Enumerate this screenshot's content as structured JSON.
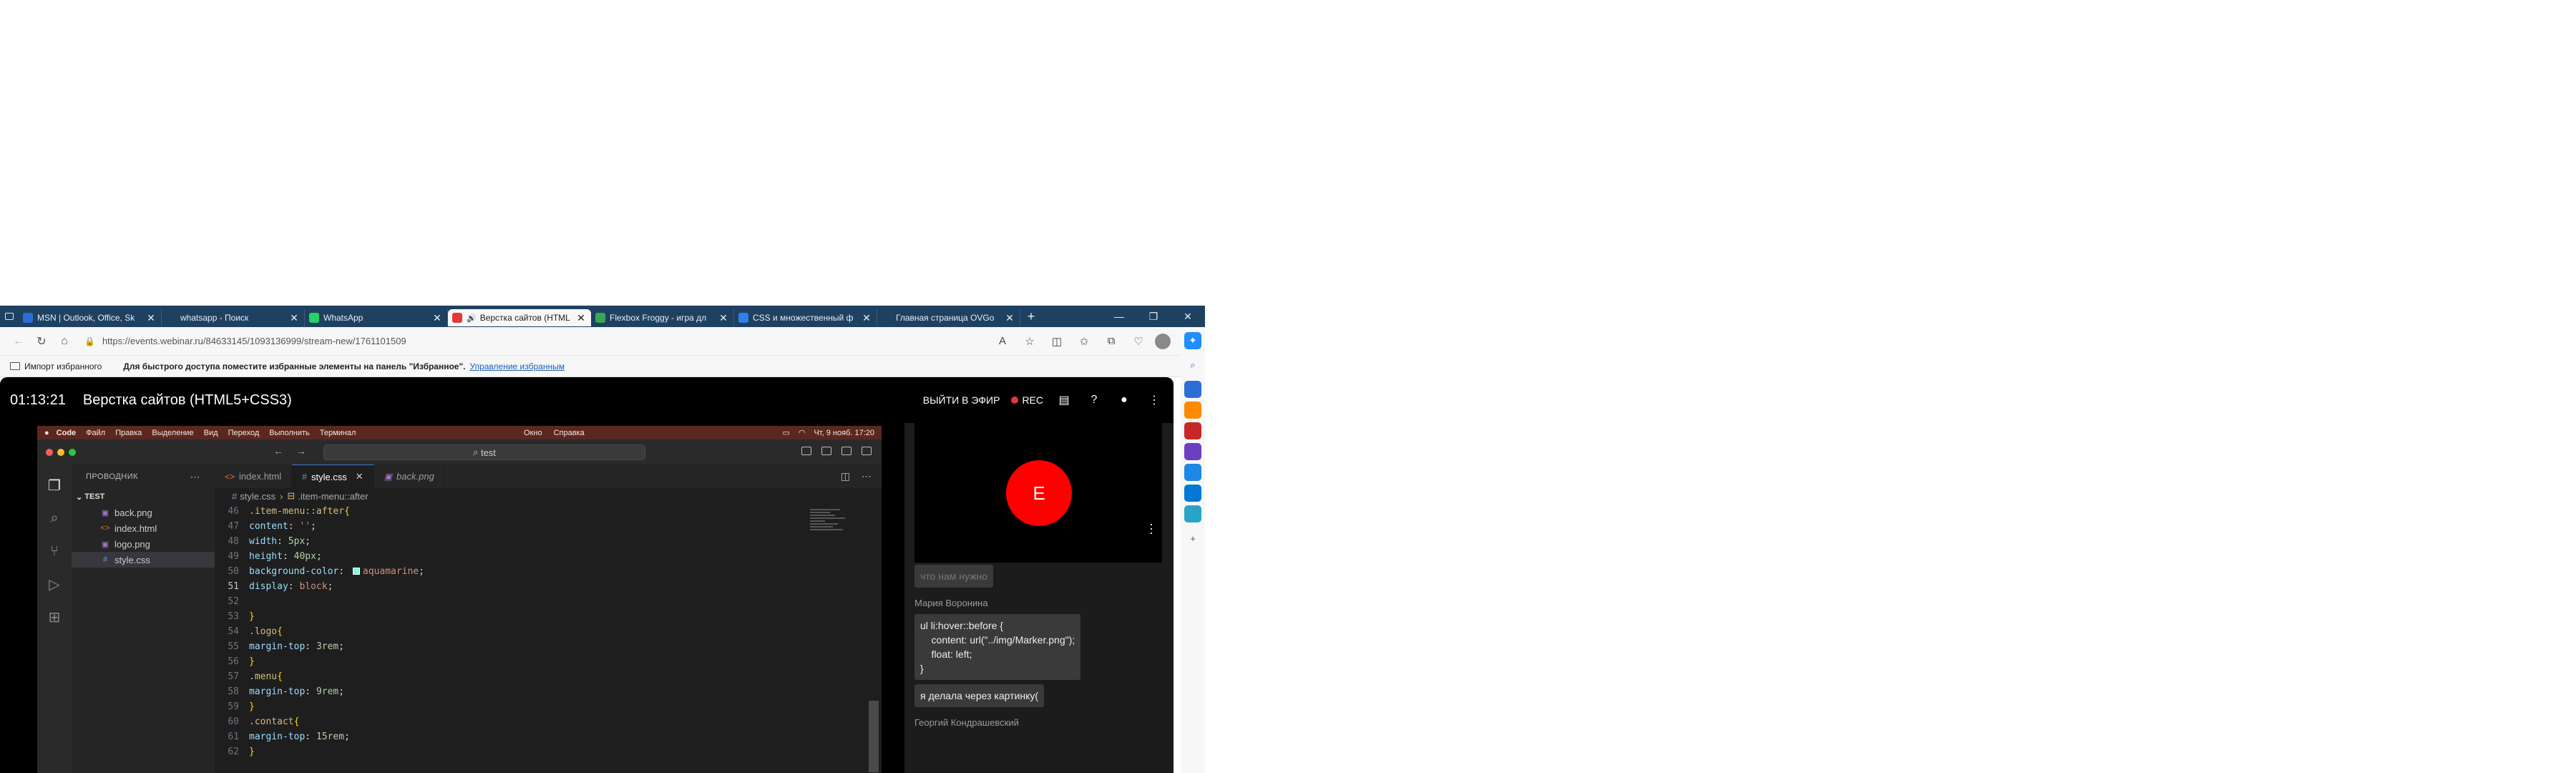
{
  "browser": {
    "tabs": [
      {
        "title": "MSN | Outlook, Office, Sk",
        "color": "#2b6fd6"
      },
      {
        "title": "whatsapp - Поиск",
        "color": "#1f4161"
      },
      {
        "title": "WhatsApp",
        "color": "#25d366"
      },
      {
        "title": "Верстка сайтов (HTML",
        "color": "#e53935",
        "active": true
      },
      {
        "title": "Flexbox Froggy - игра дл",
        "color": "#3aa655"
      },
      {
        "title": "CSS и множественный ф",
        "color": "#2f80ed"
      },
      {
        "title": "Главная страница OVGo",
        "color": "#1f4161"
      }
    ],
    "new_tab": "+",
    "url": "https://events.webinar.ru/84633145/1093136999/stream-new/1761101509",
    "favorites": {
      "import": "Импорт избранного",
      "hint": "Для быстрого доступа поместите избранные элементы на панель \"Избранное\".",
      "manage_link": "Управление избранным"
    },
    "sidebar_colors": [
      "#2b6fd6",
      "#ff8a00",
      "#c62828",
      "#6a3fc1",
      "#1e88e5",
      "#0078d4",
      "#2aa3c9"
    ]
  },
  "webinar": {
    "timer": "01:13:21",
    "title": "Верстка сайтов (HTML5+CSS3)",
    "go_live": "ВЫЙТИ В ЭФИР",
    "rec": "REC"
  },
  "mac": {
    "menus": [
      "Code",
      "Файл",
      "Правка",
      "Выделение",
      "Вид",
      "Переход",
      "Выполнить",
      "Терминал"
    ],
    "center_menus": [
      "Окно",
      "Справка"
    ],
    "clock": "Чт, 9 нояб. 17:20"
  },
  "vscode": {
    "search": "test",
    "explorer_title": "ПРОВОДНИК",
    "folder": "TEST",
    "files": [
      {
        "name": "back.png",
        "icon": "▣"
      },
      {
        "name": "index.html",
        "icon": "<>"
      },
      {
        "name": "logo.png",
        "icon": "▣"
      },
      {
        "name": "style.css",
        "icon": "#",
        "selected": true
      }
    ],
    "tabs": [
      {
        "label": "index.html",
        "icon": "<>"
      },
      {
        "label": "style.css",
        "icon": "#",
        "active": true,
        "close": "✕"
      },
      {
        "label": "back.png",
        "icon": "▣",
        "italic": true
      }
    ],
    "breadcrumb": {
      "file": "style.css",
      "symbol": ".item-menu::after"
    },
    "lines": [
      {
        "n": "46",
        "html": "<span class='sel-tok'>.item-menu::after</span><span class='brace'>{</span>"
      },
      {
        "n": "47",
        "html": "<span class='prop'>content</span>: <span class='val'>''</span>;"
      },
      {
        "n": "48",
        "html": "<span class='prop'>width</span>: <span class='numv'>5px</span>;"
      },
      {
        "n": "49",
        "html": "<span class='prop'>height</span>: <span class='numv'>40px</span>;"
      },
      {
        "n": "50",
        "html": "<span class='prop'>background-color</span>: <span class='swatch'></span><span class='val'>aquamarine</span>;"
      },
      {
        "n": "51",
        "html": "<span class='prop'>display</span>: <span class='val'>block</span>;",
        "current": true
      },
      {
        "n": "52",
        "html": ""
      },
      {
        "n": "53",
        "html": "<span class='brace'>}</span>"
      },
      {
        "n": "54",
        "html": "<span class='sel-tok'>.logo</span><span class='brace'>{</span>"
      },
      {
        "n": "55",
        "html": "<span class='prop'>margin-top</span>: <span class='numv'>3rem</span>;"
      },
      {
        "n": "56",
        "html": "<span class='brace'>}</span>"
      },
      {
        "n": "57",
        "html": "<span class='sel-tok'>.menu</span><span class='brace'>{</span>"
      },
      {
        "n": "58",
        "html": "<span class='prop'>margin-top</span>: <span class='numv'>9rem</span>;"
      },
      {
        "n": "59",
        "html": "<span class='brace'>}</span>"
      },
      {
        "n": "60",
        "html": "<span class='sel-tok'>.contact</span><span class='brace'>{</span>"
      },
      {
        "n": "61",
        "html": "<span class='prop'>margin-top</span>: <span class='numv'>15rem</span>;"
      },
      {
        "n": "62",
        "html": "<span class='brace'>}</span>"
      }
    ]
  },
  "panel": {
    "video_initial": "E",
    "chat": [
      {
        "type": "bubble",
        "faded": true,
        "text": "что нам нужно"
      },
      {
        "type": "author",
        "text": "Мария Воронина"
      },
      {
        "type": "bubble",
        "code": true,
        "text": "ul li:hover::before {\n    content: url(\"../img/Marker.png\");\n    float: left;\n}"
      },
      {
        "type": "bubble",
        "text": "я делала через картинку("
      },
      {
        "type": "author",
        "text": "Георгий Кондрашевский"
      }
    ]
  }
}
